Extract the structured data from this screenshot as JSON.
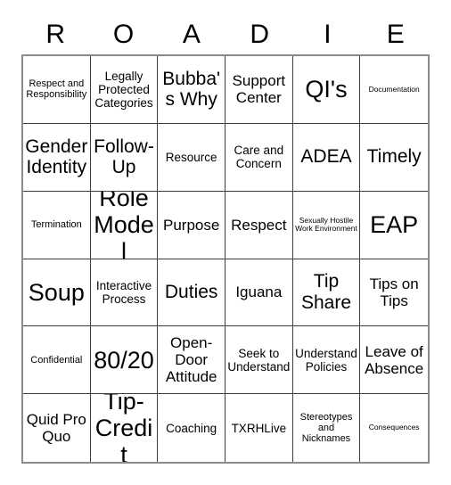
{
  "card": {
    "title_letters": [
      "R",
      "O",
      "A",
      "D",
      "I",
      "E"
    ],
    "rows": [
      [
        {
          "label": "Respect and Responsibility",
          "size": "t-sm"
        },
        {
          "label": "Legally Protected Categories",
          "size": "t-md"
        },
        {
          "label": "Bubba's Why",
          "size": "t-xl"
        },
        {
          "label": "Support Center",
          "size": "t-lg"
        },
        {
          "label": "QI's",
          "size": "t-xxl"
        },
        {
          "label": "Documentation",
          "size": "t-xs"
        }
      ],
      [
        {
          "label": "Gender Identity",
          "size": "t-xl"
        },
        {
          "label": "Follow-Up",
          "size": "t-xl"
        },
        {
          "label": "Resource",
          "size": "t-md"
        },
        {
          "label": "Care and Concern",
          "size": "t-md"
        },
        {
          "label": "ADEA",
          "size": "t-xl"
        },
        {
          "label": "Timely",
          "size": "t-xl"
        }
      ],
      [
        {
          "label": "Termination",
          "size": "t-sm"
        },
        {
          "label": "Role Model",
          "size": "t-xxl"
        },
        {
          "label": "Purpose",
          "size": "t-lg"
        },
        {
          "label": "Respect",
          "size": "t-lg"
        },
        {
          "label": "Sexually Hostile Work Environment",
          "size": "t-xs"
        },
        {
          "label": "EAP",
          "size": "t-xxl"
        }
      ],
      [
        {
          "label": "Soup",
          "size": "t-xxl"
        },
        {
          "label": "Interactive Process",
          "size": "t-md"
        },
        {
          "label": "Duties",
          "size": "t-xl"
        },
        {
          "label": "Iguana",
          "size": "t-lg"
        },
        {
          "label": "Tip Share",
          "size": "t-xl"
        },
        {
          "label": "Tips on Tips",
          "size": "t-lg"
        }
      ],
      [
        {
          "label": "Confidential",
          "size": "t-sm"
        },
        {
          "label": "80/20",
          "size": "t-xxl"
        },
        {
          "label": "Open-Door Attitude",
          "size": "t-lg"
        },
        {
          "label": "Seek to Understand",
          "size": "t-md"
        },
        {
          "label": "Understand Policies",
          "size": "t-md"
        },
        {
          "label": "Leave of Absence",
          "size": "t-lg"
        }
      ],
      [
        {
          "label": "Quid Pro Quo",
          "size": "t-lg"
        },
        {
          "label": "Tip-Credit",
          "size": "t-xxl"
        },
        {
          "label": "Coaching",
          "size": "t-md"
        },
        {
          "label": "TXRHLive",
          "size": "t-md"
        },
        {
          "label": "Stereotypes and Nicknames",
          "size": "t-sm"
        },
        {
          "label": "Consequences",
          "size": "t-xs"
        }
      ]
    ],
    "colors": {
      "background": "#ffffff",
      "text": "#000000",
      "inner_border": "#3d3d3d",
      "outer_border": "#8a8a8a"
    }
  }
}
